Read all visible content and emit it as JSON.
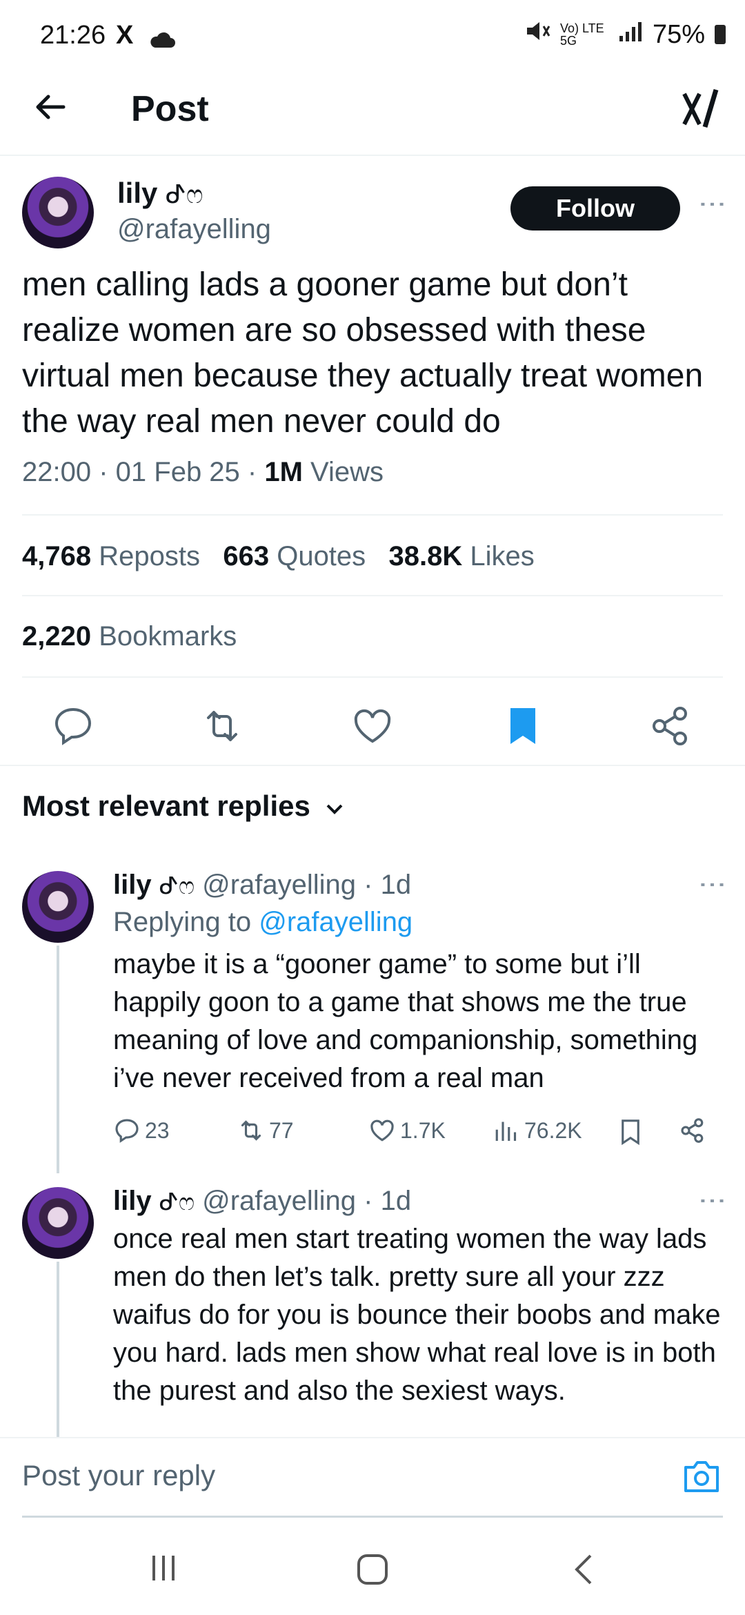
{
  "status_bar": {
    "time": "21:26",
    "x_icon": "X",
    "signal_text": "Vo) LTE 5G",
    "battery": "75%"
  },
  "header": {
    "title": "Post"
  },
  "post": {
    "author_name": "lily",
    "author_emoji": "ᕷෆ",
    "author_handle": "@rafayelling",
    "follow_label": "Follow",
    "text": "men calling lads a gooner game but don’t realize women are so obsessed with these virtual men because they actually treat women the way real men never could do",
    "time": "22:00",
    "date": "01 Feb 25",
    "views_count": "1M",
    "views_label": "Views",
    "reposts_count": "4,768",
    "reposts_label": "Reposts",
    "quotes_count": "663",
    "quotes_label": "Quotes",
    "likes_count": "38.8K",
    "likes_label": "Likes",
    "bookmarks_count": "2,220",
    "bookmarks_label": "Bookmarks",
    "bookmarked": true,
    "accent_color": "#1d9bf0"
  },
  "replies_section": {
    "sort_label": "Most relevant replies"
  },
  "replies": [
    {
      "name": "lily",
      "emoji": "ᕷෆ",
      "handle": "@rafayelling",
      "age": "1d",
      "replying_prefix": "Replying to",
      "replying_handle": "@rafayelling",
      "text": "maybe it is a “gooner game” to some but i’ll happily goon to a game that shows me the true meaning of love and companionship, something i’ve never received from a real man",
      "replies": "23",
      "reposts": "77",
      "likes": "1.7K",
      "views": "76.2K"
    },
    {
      "name": "lily",
      "emoji": "ᕷෆ",
      "handle": "@rafayelling",
      "age": "1d",
      "text": "once real men start treating women the way lads men do then let’s talk. pretty sure all your zzz waifus do for you is bounce their boobs and make you hard. lads men show what real love is in both the purest and also the sexiest ways."
    }
  ],
  "composer": {
    "placeholder": "Post your reply"
  }
}
